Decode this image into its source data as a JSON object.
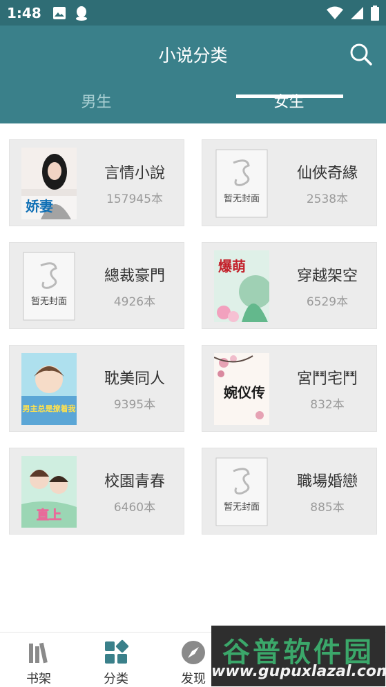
{
  "status_bar": {
    "time": "1:48"
  },
  "app_bar": {
    "title": "小说分类"
  },
  "tabs": [
    {
      "label": "男生",
      "active": false
    },
    {
      "label": "女生",
      "active": true
    }
  ],
  "categories": [
    {
      "title": "言情小說",
      "count": "157945本"
    },
    {
      "title": "仙俠奇緣",
      "count": "2538本"
    },
    {
      "title": "總裁豪門",
      "count": "4926本"
    },
    {
      "title": "穿越架空",
      "count": "6529本"
    },
    {
      "title": "耽美同人",
      "count": "9395本"
    },
    {
      "title": "宮鬥宅鬥",
      "count": "832本"
    },
    {
      "title": "校園青春",
      "count": "6460本"
    },
    {
      "title": "職場婚戀",
      "count": "885本"
    }
  ],
  "covers": {
    "placeholder_text": "暂无封面",
    "book1_title": "娇妻",
    "book4_title": "爆萌",
    "book5_title": "男主总是撩着我",
    "book6_title": "婉仪传",
    "book7_title": "直上"
  },
  "bottom_nav": [
    {
      "label": "书架",
      "icon": "bookshelf-icon"
    },
    {
      "label": "分类",
      "icon": "category-icon"
    },
    {
      "label": "发现",
      "icon": "compass-icon"
    }
  ],
  "watermark": {
    "name": "谷普软件园",
    "url": "www.gupuxlazal.com"
  },
  "colors": {
    "primary": "#3a808a",
    "status_bar": "#2f6d75",
    "card_bg": "#ececec"
  }
}
